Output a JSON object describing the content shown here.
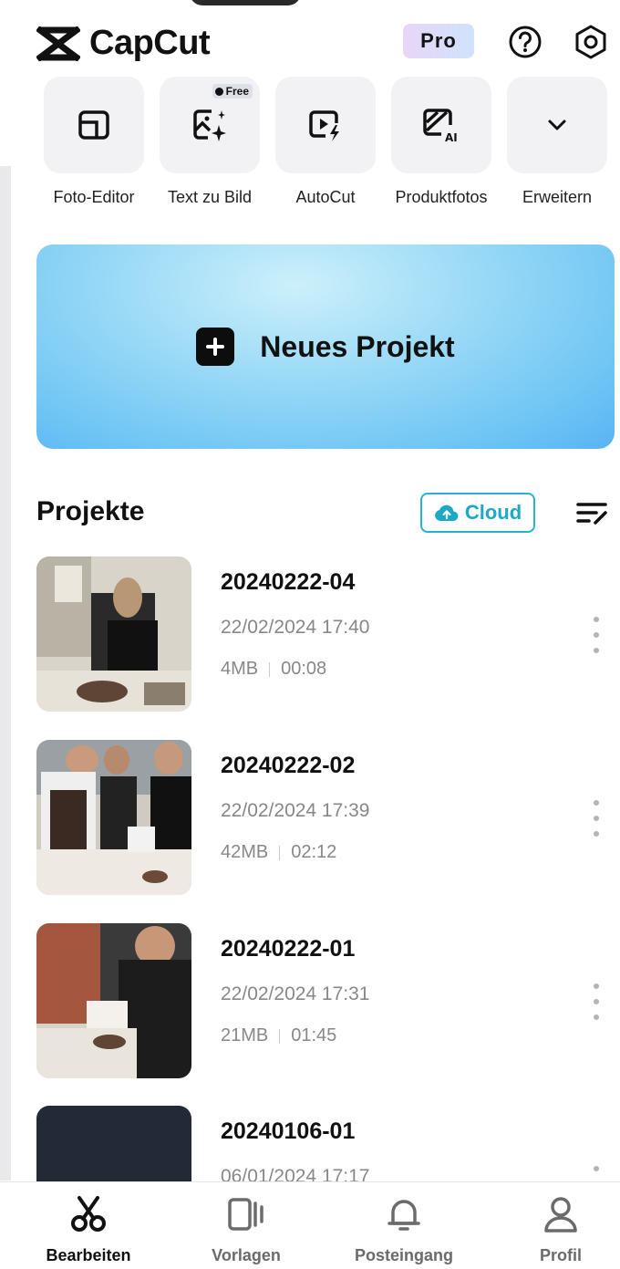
{
  "app": {
    "name": "CapCut",
    "pro_label": "Pro"
  },
  "tools": [
    {
      "label": "Foto-Editor",
      "icon": "photo-editor-icon"
    },
    {
      "label": "Text zu Bild",
      "icon": "text-to-image-icon",
      "badge": "Free"
    },
    {
      "label": "AutoCut",
      "icon": "autocut-icon"
    },
    {
      "label": "Produktfotos",
      "icon": "product-photo-icon"
    },
    {
      "label": "Erweitern",
      "icon": "chevron-down-icon"
    }
  ],
  "new_project": {
    "label": "Neues Projekt"
  },
  "projects_section": {
    "title": "Projekte",
    "cloud_label": "Cloud"
  },
  "projects": [
    {
      "title": "20240222-04",
      "date": "22/02/2024 17:40",
      "size": "4MB",
      "duration": "00:08"
    },
    {
      "title": "20240222-02",
      "date": "22/02/2024 17:39",
      "size": "42MB",
      "duration": "02:12"
    },
    {
      "title": "20240222-01",
      "date": "22/02/2024 17:31",
      "size": "21MB",
      "duration": "01:45"
    },
    {
      "title": "20240106-01",
      "date": "06/01/2024 17:17",
      "size": "",
      "duration": ""
    }
  ],
  "nav": [
    {
      "label": "Bearbeiten",
      "icon": "scissors-icon",
      "active": true
    },
    {
      "label": "Vorlagen",
      "icon": "templates-icon",
      "active": false
    },
    {
      "label": "Posteingang",
      "icon": "bell-icon",
      "active": false
    },
    {
      "label": "Profil",
      "icon": "profile-icon",
      "active": false
    }
  ],
  "colors": {
    "accent": "#25b4d0",
    "banner_start": "#cdf0fb",
    "banner_end": "#58b3f3",
    "text": "#111111",
    "muted": "#888888"
  }
}
